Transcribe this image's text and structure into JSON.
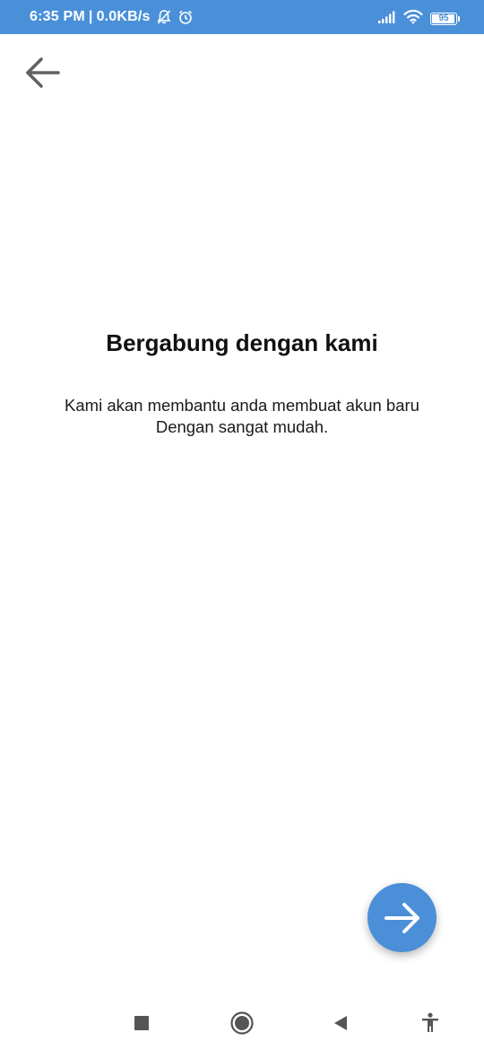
{
  "status_bar": {
    "time": "6:35 PM",
    "network_speed": "0.0KB/s",
    "separator": "|",
    "icons": [
      "bell-off-icon",
      "alarm-clock-icon",
      "signal-icon",
      "wifi-icon",
      "battery-icon"
    ],
    "battery_level": "95",
    "battery_fraction": 0.95,
    "background_color": "#4a90d9"
  },
  "toolbar": {
    "back_icon": "arrow-left-icon"
  },
  "main": {
    "title": "Bergabung dengan kami",
    "description_line1": "Kami akan membantu anda membuat akun baru",
    "description_line2": "Dengan sangat mudah."
  },
  "fab": {
    "icon": "arrow-right-icon",
    "color": "#4a8fd8"
  },
  "nav_bar": {
    "items": [
      "recents-square-icon",
      "home-circle-icon",
      "back-triangle-icon",
      "accessibility-icon"
    ]
  }
}
